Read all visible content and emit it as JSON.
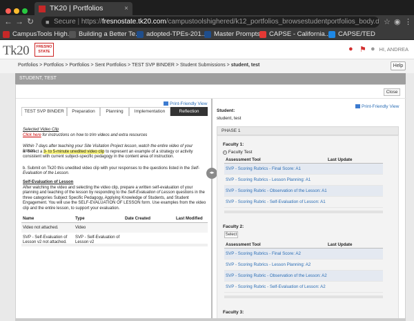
{
  "browser": {
    "tab_title": "TK20 | Portfolios",
    "tab_close": "×",
    "url_secure": "Secure",
    "url_scheme": "https://",
    "url_host": "fresnostate.tk20.com",
    "url_path": "/campustoolshighered/k12_portfolios_browsestudentportfolios_body.do?acti...",
    "bookmarks": [
      {
        "label": "CampusTools High...",
        "color": "#c62828"
      },
      {
        "label": "Building a Better Te...",
        "color": "#555555"
      },
      {
        "label": "adopted-TPEs-201...",
        "color": "#1f4e8c"
      },
      {
        "label": "Master Prompts",
        "color": "#1f4e8c"
      },
      {
        "label": "CAPSE - California...",
        "color": "#e53935"
      },
      {
        "label": "CAPSE/TED",
        "color": "#1e88e5"
      }
    ],
    "bookmark_icon_labels": [
      "AF",
      "CTC",
      "CTC"
    ]
  },
  "header": {
    "logo_text": "Tk20",
    "logo_sub": "FRESNO STATE",
    "user_label": "HI, ANDREA"
  },
  "breadcrumbs": {
    "items": [
      "Portfolios",
      "Portfolios",
      "Portfolios",
      "Sent Portfolios",
      "TEST SVP BINDER",
      "Student Submissions"
    ],
    "current": "student, test",
    "separator": ">"
  },
  "help_label": "Help",
  "student_bar": "STUDENT, TEST",
  "close_label": "Close",
  "left": {
    "print_label": "Print-Friendly View",
    "tabs": [
      "TEST SVP BINDER",
      "Preparation",
      "Planning",
      "Implementation",
      "Reflection"
    ],
    "active_tab": "Reflection",
    "selected_video_heading": "Selected Video Clip",
    "click_here": "Click here",
    "click_here_rest": " for instructions on how to trim videos and extra resources",
    "p1": "Within 7 days after teaching your Site Visitation Project lesson, watch the entire video of your lesson.",
    "p2a": "a. Select a ",
    "p2_hl": "3- to 5-minute unedited video clip",
    "p2b": " to represent an example of a strategy or activity consistent with current subject-specific pedagogy in the content area of instruction.",
    "p3a": "b. Submit on Tk20 this unedited video clip with your responses to the questions listed in the ",
    "p3_i": "Self-Evaluation of the Lesson",
    "p3b": ".",
    "self_eval_heading": "Self-Evaluation of Lesson",
    "p4a": "After watching the video and selecting the video clip, prepare a written self-evaluation of your planning and teaching of the lesson by responding to the ",
    "p4_i": "Self-Evaluation of Lesson",
    "p4b": " questions in the three categories Subject Specific Pedagogy, Applying Knowledge of Students, and Student Engagement. You will use the SELF-EVALUATION OF LESSON form. Use examples from the video clip and the entire lesson, to support your evaluation.",
    "table_headers": [
      "Name",
      "Type",
      "Date Created",
      "Last Modified"
    ],
    "table_rows": [
      {
        "name": "Video not attached.",
        "type": "Video"
      },
      {
        "name": "SVP - Self-Evaluation of Lesson v2 not attached.",
        "type": "SVP - Self-Evaluation of Lesson v2"
      }
    ]
  },
  "right": {
    "print_label": "Print-Friendly View",
    "student_label": "Student:",
    "student_name": "student, test",
    "phase": "PHASE 1",
    "faculty1_label": "Faculty 1:",
    "faculty1_name": "Faculty Test",
    "faculty1_collapse": "−",
    "faculty2_label": "Faculty 2:",
    "select_label": "Select",
    "faculty3_label": "Faculty 3:",
    "col_tool": "Assessment Tool",
    "col_update": "Last Update",
    "faculty1_rows": [
      "SVP - Scoring Rubrics - Final Score: A1",
      "SVP - Scoring Rubrics - Lesson Planning: A1",
      "SVP - Scoring Rubric - Observation of the Lesson: A1",
      "SVP - Scoring Rubric - Self-Evaluation of Lesson: A1"
    ],
    "faculty2_rows": [
      "SVP - Scoring Rubrics - Final Score: A2",
      "SVP - Scoring Rubrics - Lesson Planning: A2",
      "SVP - Scoring Rubric - Observation of the Lesson: A2",
      "SVP - Scoring Rubric - Self-Evaluation of Lesson: A2"
    ]
  }
}
